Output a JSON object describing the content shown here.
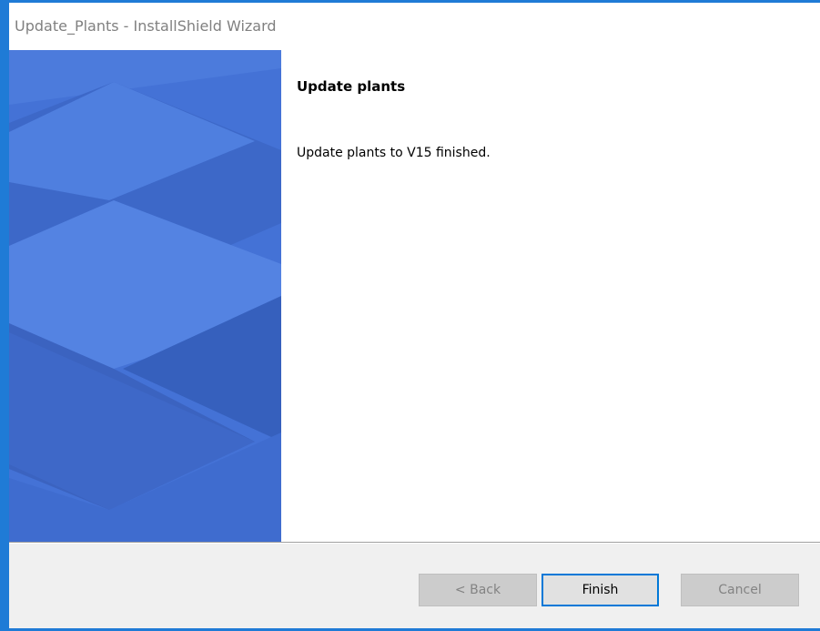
{
  "window": {
    "title": "Update_Plants - InstallShield Wizard"
  },
  "content": {
    "heading": "Update plants",
    "message": "Update plants to V15 finished."
  },
  "buttons": {
    "back": {
      "label": "< Back",
      "enabled": false
    },
    "finish": {
      "label": "Finish",
      "enabled": true,
      "default": true
    },
    "cancel": {
      "label": "Cancel",
      "enabled": false
    }
  },
  "colors": {
    "accent": "#1f7bd6",
    "panel": "#4370d4",
    "focus_border": "#0078d7"
  }
}
